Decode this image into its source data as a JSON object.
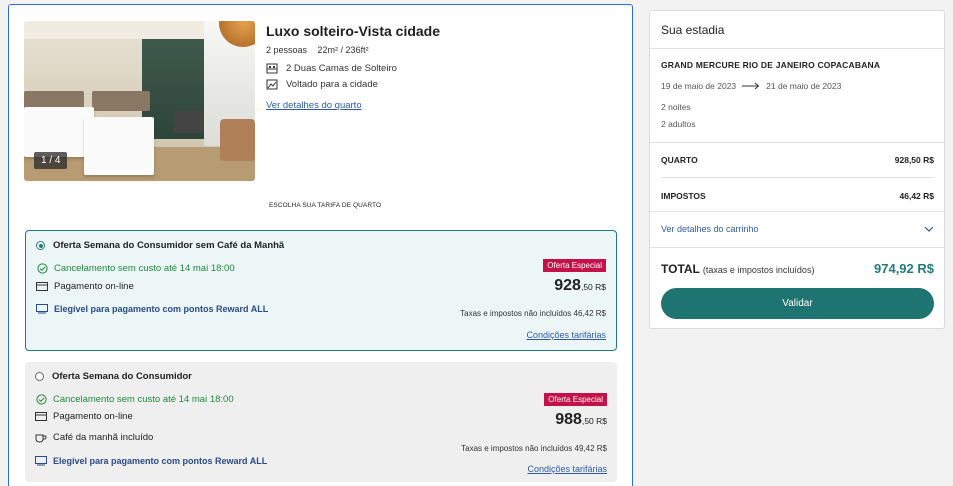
{
  "room": {
    "image_counter": "1 / 4",
    "title": "Luxo solteiro-Vista cidade",
    "guests": "2 pessoas",
    "size": "22m² / 236ft²",
    "beds": "2 Duas Camas de Solteiro",
    "view": "Voltado para a cidade",
    "details_link": "Ver detalhes do quarto"
  },
  "choose_rate_label": "ESCOLHA SUA TARIFA DE QUARTO",
  "rates": [
    {
      "title": "Oferta Semana do Consumidor sem Café da Manhã",
      "selected": true,
      "cancellation": "Cancelamento sem custo até 14 mai 18:00",
      "payment": "Pagamento on-line",
      "reward": "Elegível para pagamento com pontos Reward ALL",
      "badge": "Oferta Especial",
      "price_main": "928",
      "price_cents": ",50 R$",
      "tax_note": "Taxas e impostos não incluídos 46,42 R$",
      "conditions_link": "Condições tarifárias"
    },
    {
      "title": "Oferta Semana do Consumidor",
      "selected": false,
      "cancellation": "Cancelamento sem custo até 14 mai 18:00",
      "payment": "Pagamento on-line",
      "breakfast": "Café da manhã incluído",
      "reward": "Elegível para pagamento com pontos Reward ALL",
      "badge": "Oferta Especial",
      "price_main": "988",
      "price_cents": ",50 R$",
      "tax_note": "Taxas e impostos não incluídos 49,42 R$",
      "conditions_link": "Condições tarifárias"
    }
  ],
  "summary": {
    "heading": "Sua estadia",
    "hotel": "GRAND MERCURE RIO DE JANEIRO COPACABANA",
    "checkin": "19 de maio de 2023",
    "checkout": "21 de maio de 2023",
    "nights": "2 noites",
    "adults": "2 adultos",
    "room_label": "QUARTO",
    "room_value": "928,50 R$",
    "tax_label": "IMPOSTOS",
    "tax_value": "46,42 R$",
    "cart_link": "Ver detalhes do carrinho",
    "total_label": "TOTAL",
    "total_note": "(taxas e impostos incluídos)",
    "total_value": "974,92 R$",
    "validate_button": "Validar"
  },
  "colors": {
    "accent": "#237a7a",
    "badge": "#c4114a",
    "link": "#2f5ba6",
    "success": "#1e8a3c",
    "selected_border": "#2f6bd6"
  }
}
